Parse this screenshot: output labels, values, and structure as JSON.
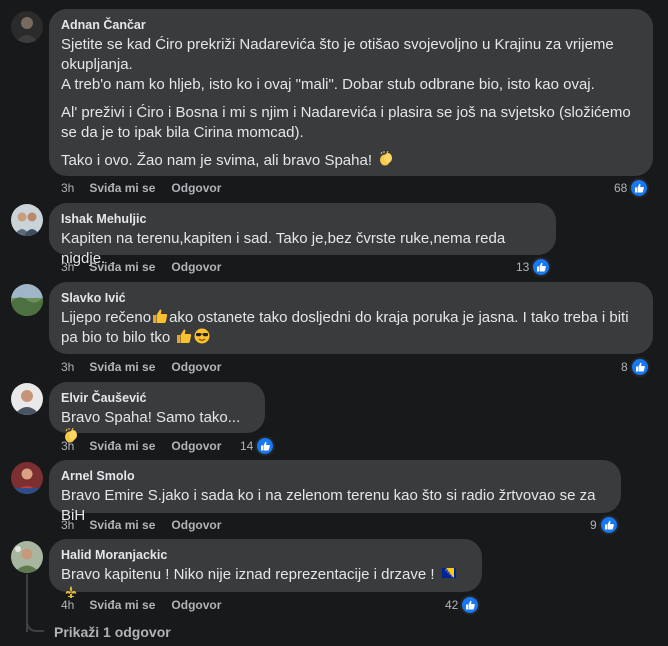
{
  "actions": {
    "like_label": "Sviđa mi se",
    "reply_label": "Odgovor"
  },
  "comments": [
    {
      "author": "Adnan Čančar",
      "paragraphs": [
        "Sjetite se kad Ćiro prekriži Nadarevića što je otišao svojevoljno u Krajinu za vrijeme okupljanja.\nA treb'o nam ko hljeb, isto ko i ovaj \"mali\". Dobar stub odbrane bio, isto kao ovaj.",
        "Al' preživi i Ćiro i Bosna i mi s njim i Nadarevića i plasira se još na svjetsko (složićemo se da je to ipak bila Cirina momcad).",
        "Tako i ovo. Žao nam je svima, ali bravo Spaha!"
      ],
      "time": "3h",
      "reactions": "68",
      "emoji": "clapping-hands"
    },
    {
      "author": "Ishak Mehuljic",
      "paragraphs": [
        "Kapiten na terenu,kapiten i sad. Tako je,bez čvrste ruke,nema reda nigdje."
      ],
      "time": "3h",
      "reactions": "13"
    },
    {
      "author": "Slavko Ivić",
      "paragraphs": [
        "Lijepo rečeno",
        "ako ostanete tako dosljedni do kraja poruka je jasna. I tako treba i biti pa bio to bilo tko"
      ],
      "time": "3h",
      "reactions": "8"
    },
    {
      "author": "Elvir Čaušević",
      "paragraphs": [
        "Bravo Spaha! Samo tako..."
      ],
      "time": "3h",
      "reactions": "14"
    },
    {
      "author": "Arnel Smolo",
      "paragraphs": [
        "Bravo Emire S.jako i sada ko i na zelenom terenu kao što si radio žrtvovao se za BiH"
      ],
      "time": "3h",
      "reactions": "9"
    },
    {
      "author": "Halid Moranjackic",
      "paragraphs": [
        "Bravo kapitenu ! Niko nije iznad reprezentacije i drzave !"
      ],
      "time": "4h",
      "reactions": "42"
    }
  ],
  "show_replies_label": "Prikaži 1 odgovor",
  "colors": {
    "background": "#18191a",
    "bubble": "#3a3b3c",
    "like_blue": "#1877f2",
    "muted": "#b0b3b8"
  }
}
